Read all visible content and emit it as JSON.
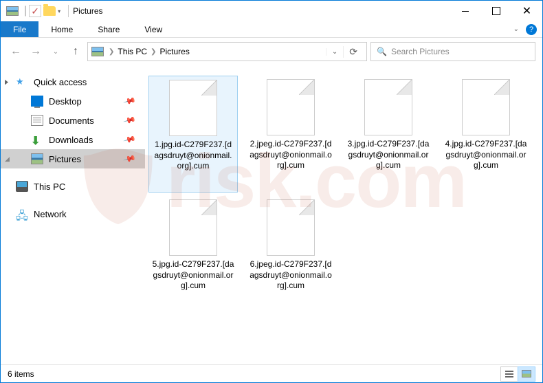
{
  "window": {
    "title": "Pictures"
  },
  "ribbon": {
    "file": "File",
    "home": "Home",
    "share": "Share",
    "view": "View"
  },
  "path": {
    "crumb1": "This PC",
    "crumb2": "Pictures"
  },
  "search": {
    "placeholder": "Search Pictures"
  },
  "sidebar": {
    "quick": "Quick access",
    "desktop": "Desktop",
    "documents": "Documents",
    "downloads": "Downloads",
    "pictures": "Pictures",
    "thispc": "This PC",
    "network": "Network"
  },
  "files": [
    {
      "name": "1.jpg.id-C279F237.[dagsdruyt@onionmail.org].cum"
    },
    {
      "name": "2.jpeg.id-C279F237.[dagsdruyt@onionmail.org].cum"
    },
    {
      "name": "3.jpg.id-C279F237.[dagsdruyt@onionmail.org].cum"
    },
    {
      "name": "4.jpg.id-C279F237.[dagsdruyt@onionmail.org].cum"
    },
    {
      "name": "5.jpg.id-C279F237.[dagsdruyt@onionmail.org].cum"
    },
    {
      "name": "6.jpeg.id-C279F237.[dagsdruyt@onionmail.org].cum"
    }
  ],
  "status": {
    "count": "6 items"
  },
  "watermark": "risk.com"
}
